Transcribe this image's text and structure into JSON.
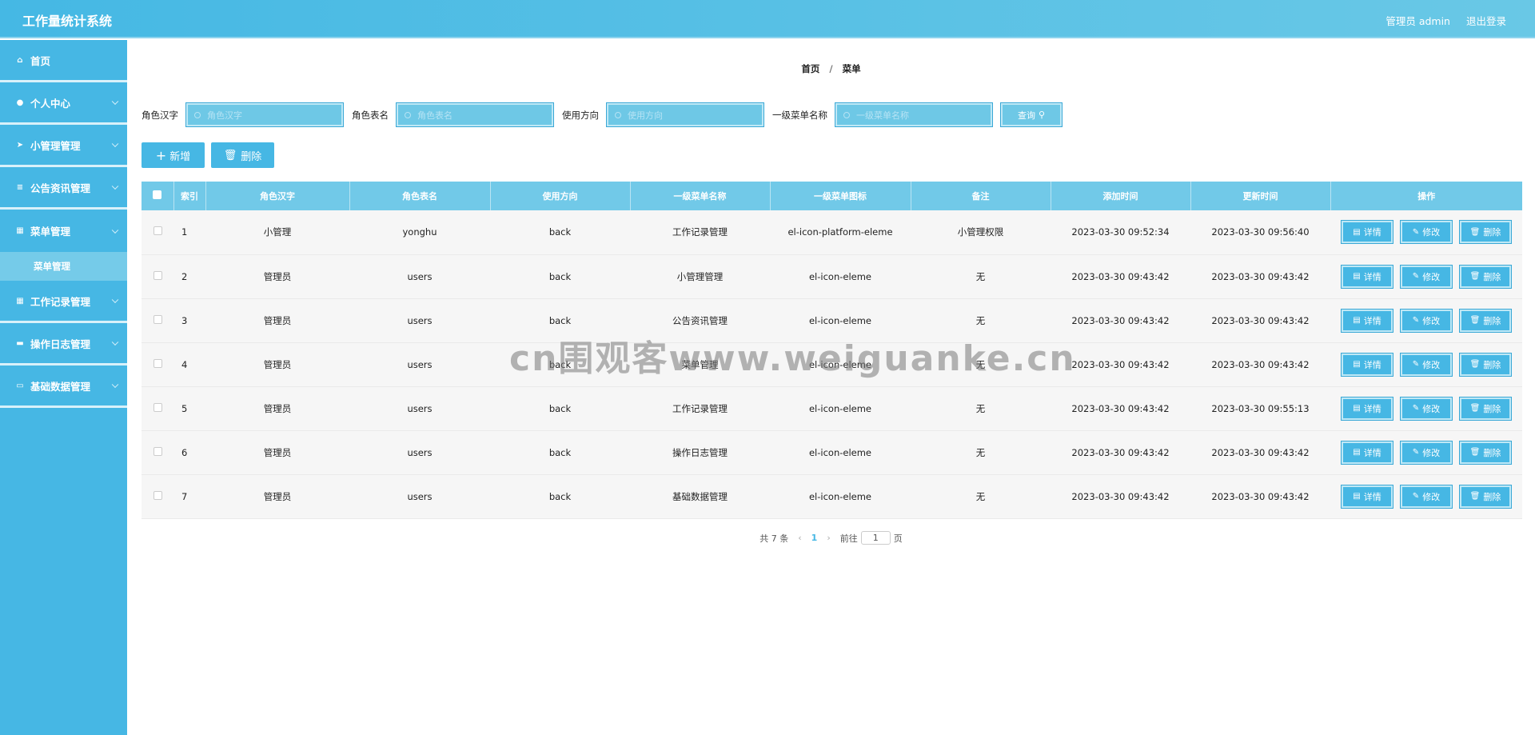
{
  "header": {
    "title": "工作量统计系统",
    "user": "管理员 admin",
    "logout": "退出登录"
  },
  "sidebar": {
    "items": [
      {
        "label": "首页",
        "icon": "home-icon"
      },
      {
        "label": "个人中心",
        "icon": "user-icon"
      },
      {
        "label": "小管理管理",
        "icon": "send-icon"
      },
      {
        "label": "公告资讯管理",
        "icon": "list-icon"
      },
      {
        "label": "菜单管理",
        "icon": "menu-icon"
      },
      {
        "label": "工作记录管理",
        "icon": "grid-icon"
      },
      {
        "label": "操作日志管理",
        "icon": "doc-icon"
      },
      {
        "label": "基础数据管理",
        "icon": "monitor-icon"
      }
    ],
    "submenu": {
      "label": "菜单管理"
    }
  },
  "breadcrumb": {
    "home": "首页",
    "sep": "/",
    "current": "菜单"
  },
  "search": {
    "fields": [
      {
        "label": "角色汉字",
        "placeholder": "角色汉字"
      },
      {
        "label": "角色表名",
        "placeholder": "角色表名"
      },
      {
        "label": "使用方向",
        "placeholder": "使用方向"
      },
      {
        "label": "一级菜单名称",
        "placeholder": "一级菜单名称"
      }
    ],
    "query": "查询"
  },
  "actions": {
    "add": "新增",
    "delete": "删除"
  },
  "table": {
    "columns": [
      "索引",
      "角色汉字",
      "角色表名",
      "使用方向",
      "一级菜单名称",
      "一级菜单图标",
      "备注",
      "添加时间",
      "更新时间",
      "操作"
    ],
    "rows": [
      {
        "idx": "1",
        "cn": "小管理",
        "table": "yonghu",
        "dir": "back",
        "menu": "工作记录管理",
        "icon": "el-icon-platform-eleme",
        "note": "小管理权限",
        "added": "2023-03-30 09:52:34",
        "updated": "2023-03-30 09:56:40"
      },
      {
        "idx": "2",
        "cn": "管理员",
        "table": "users",
        "dir": "back",
        "menu": "小管理管理",
        "icon": "el-icon-eleme",
        "note": "无",
        "added": "2023-03-30 09:43:42",
        "updated": "2023-03-30 09:43:42"
      },
      {
        "idx": "3",
        "cn": "管理员",
        "table": "users",
        "dir": "back",
        "menu": "公告资讯管理",
        "icon": "el-icon-eleme",
        "note": "无",
        "added": "2023-03-30 09:43:42",
        "updated": "2023-03-30 09:43:42"
      },
      {
        "idx": "4",
        "cn": "管理员",
        "table": "users",
        "dir": "back",
        "menu": "菜单管理",
        "icon": "el-icon-eleme",
        "note": "无",
        "added": "2023-03-30 09:43:42",
        "updated": "2023-03-30 09:43:42"
      },
      {
        "idx": "5",
        "cn": "管理员",
        "table": "users",
        "dir": "back",
        "menu": "工作记录管理",
        "icon": "el-icon-eleme",
        "note": "无",
        "added": "2023-03-30 09:43:42",
        "updated": "2023-03-30 09:55:13"
      },
      {
        "idx": "6",
        "cn": "管理员",
        "table": "users",
        "dir": "back",
        "menu": "操作日志管理",
        "icon": "el-icon-eleme",
        "note": "无",
        "added": "2023-03-30 09:43:42",
        "updated": "2023-03-30 09:43:42"
      },
      {
        "idx": "7",
        "cn": "管理员",
        "table": "users",
        "dir": "back",
        "menu": "基础数据管理",
        "icon": "el-icon-eleme",
        "note": "无",
        "added": "2023-03-30 09:43:42",
        "updated": "2023-03-30 09:43:42"
      }
    ],
    "ops": {
      "detail": "详情",
      "edit": "修改",
      "delete": "删除"
    }
  },
  "pager": {
    "total": "共 7 条",
    "page": "1",
    "goto": "前往",
    "goto_value": "1",
    "unit": "页"
  },
  "watermark": "cn围观客www.weiguanke.cn",
  "colors": {
    "primary": "#46b7e4",
    "header": "#45b8e4",
    "table_header": "#71c9e8"
  }
}
